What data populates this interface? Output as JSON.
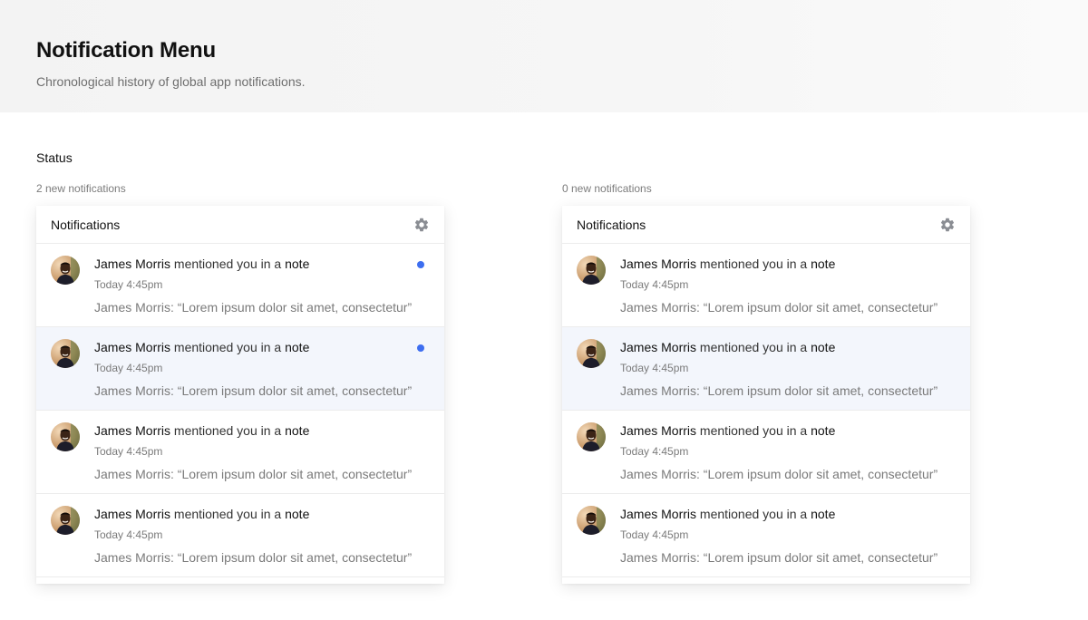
{
  "page": {
    "title": "Notification Menu",
    "subtitle": "Chronological history of global app notifications."
  },
  "section": {
    "label": "Status"
  },
  "colors": {
    "accent": "#3d6ef0",
    "hover_row": "#f3f6fc"
  },
  "panels": [
    {
      "count_text": "2 new notifications",
      "title": "Notifications",
      "settings_icon": "gear-icon",
      "items": [
        {
          "author": "James Morris",
          "action": "mentioned you in a",
          "object": "note",
          "time": "Today 4:45pm",
          "preview": "James Morris: “Lorem ipsum dolor sit amet, consectetur”",
          "unread": true,
          "highlighted": false
        },
        {
          "author": "James Morris",
          "action": "mentioned you in a",
          "object": "note",
          "time": "Today 4:45pm",
          "preview": "James Morris: “Lorem ipsum dolor sit amet, consectetur”",
          "unread": true,
          "highlighted": true
        },
        {
          "author": "James Morris",
          "action": "mentioned you in a",
          "object": "note",
          "time": "Today 4:45pm",
          "preview": "James Morris: “Lorem ipsum dolor sit amet, consectetur”",
          "unread": false,
          "highlighted": false
        },
        {
          "author": "James Morris",
          "action": "mentioned you in a",
          "object": "note",
          "time": "Today 4:45pm",
          "preview": "James Morris: “Lorem ipsum dolor sit amet, consectetur”",
          "unread": false,
          "highlighted": false
        }
      ]
    },
    {
      "count_text": "0 new notifications",
      "title": "Notifications",
      "settings_icon": "gear-icon",
      "items": [
        {
          "author": "James Morris",
          "action": "mentioned you in a",
          "object": "note",
          "time": "Today 4:45pm",
          "preview": "James Morris: “Lorem ipsum dolor sit amet, consectetur”",
          "unread": false,
          "highlighted": false
        },
        {
          "author": "James Morris",
          "action": "mentioned you in a",
          "object": "note",
          "time": "Today 4:45pm",
          "preview": "James Morris: “Lorem ipsum dolor sit amet, consectetur”",
          "unread": false,
          "highlighted": true
        },
        {
          "author": "James Morris",
          "action": "mentioned you in a",
          "object": "note",
          "time": "Today 4:45pm",
          "preview": "James Morris: “Lorem ipsum dolor sit amet, consectetur”",
          "unread": false,
          "highlighted": false
        },
        {
          "author": "James Morris",
          "action": "mentioned you in a",
          "object": "note",
          "time": "Today 4:45pm",
          "preview": "James Morris: “Lorem ipsum dolor sit amet, consectetur”",
          "unread": false,
          "highlighted": false
        }
      ]
    }
  ]
}
